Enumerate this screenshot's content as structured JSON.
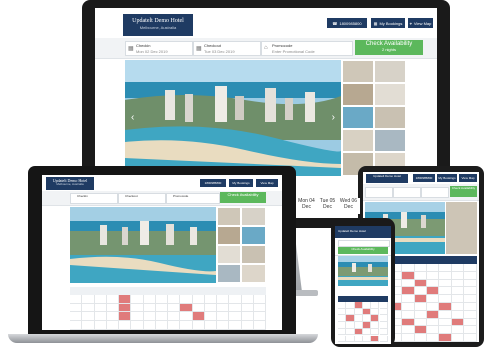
{
  "hotel": {
    "name": "Updatelt Demo Hotel",
    "location": "Melbourne, Australia"
  },
  "nav": {
    "phone": "1800985800",
    "bookings": "My Bookings",
    "map": "View Map"
  },
  "search": {
    "checkin_label": "Checkin",
    "checkin_value": "Mon 02 Dec 2019",
    "checkout_label": "Checkout",
    "checkout_value": "Tue 03 Dec 2019",
    "promo_label": "Promocode",
    "promo_value": "Enter Promotional Code",
    "cta_title": "Check Availability",
    "cta_sub": "2 nights"
  },
  "tablet_dates": [
    {
      "day": "Mon 04",
      "mon": "Dec"
    },
    {
      "day": "Tue 05",
      "mon": "Dec"
    },
    {
      "day": "Wed 06",
      "mon": "Dec"
    }
  ],
  "colors": {
    "brand": "#1f3b63",
    "cta": "#5cb85c",
    "unavailable": "#e07b7b",
    "sea": "#2a8fb0"
  }
}
